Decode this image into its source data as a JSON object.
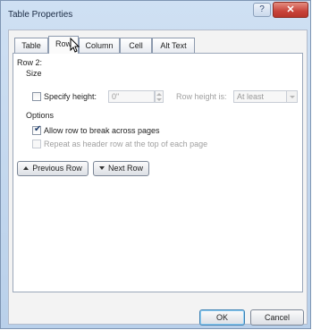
{
  "window": {
    "title": "Table Properties",
    "help_label": "?",
    "close_label": "✕"
  },
  "tabs": [
    {
      "label": "Table",
      "active": false
    },
    {
      "label": "Row",
      "active": true
    },
    {
      "label": "Column",
      "active": false
    },
    {
      "label": "Cell",
      "active": false
    },
    {
      "label": "Alt Text",
      "active": false
    }
  ],
  "row_page": {
    "row_title": "Row 2:",
    "size_heading": "Size",
    "specify_height_label": "Specify height:",
    "specify_height_checked": false,
    "height_value": "0\"",
    "row_height_is_label": "Row height is:",
    "row_height_is_value": "At least",
    "options_heading": "Options",
    "allow_break_label": "Allow row to break across pages",
    "allow_break_checked": true,
    "repeat_header_label": "Repeat as header row at the top of each page",
    "repeat_header_checked": false,
    "previous_row_label": "Previous Row",
    "next_row_label": "Next Row"
  },
  "footer": {
    "ok_label": "OK",
    "cancel_label": "Cancel"
  },
  "icons": {
    "cursor": "mouse-pointer-icon",
    "checkmark": "checkmark-icon",
    "previous": "triangle-up-icon",
    "next": "triangle-down-icon"
  }
}
